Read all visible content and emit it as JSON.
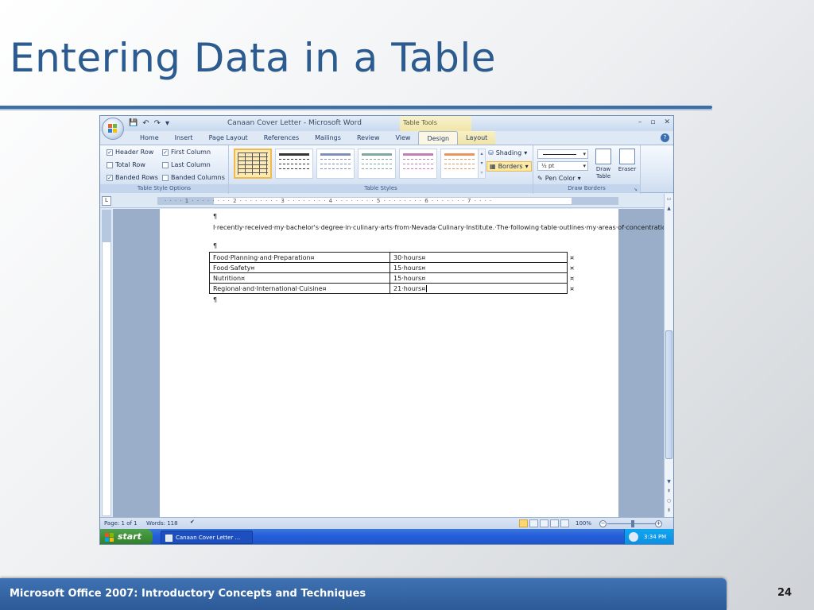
{
  "slide": {
    "title": "Entering Data in a Table",
    "footer": "Microsoft Office 2007: Introductory Concepts and Techniques",
    "page_number": "24"
  },
  "window": {
    "title": "Canaan Cover Letter - Microsoft Word",
    "context_title": "Table Tools",
    "controls": {
      "minimize": "–",
      "restore": "▫",
      "close": "✕"
    }
  },
  "quick_access": {
    "save": "💾",
    "undo": "↶",
    "redo": "↷",
    "more": "▾"
  },
  "tabs": [
    {
      "label": "Home"
    },
    {
      "label": "Insert"
    },
    {
      "label": "Page Layout"
    },
    {
      "label": "References"
    },
    {
      "label": "Mailings"
    },
    {
      "label": "Review"
    },
    {
      "label": "View"
    },
    {
      "label": "Design"
    },
    {
      "label": "Layout"
    }
  ],
  "active_tab": "Design",
  "ribbon": {
    "table_style_options": {
      "label": "Table Style Options",
      "options": [
        {
          "label": "Header Row",
          "checked": true
        },
        {
          "label": "First Column",
          "checked": true
        },
        {
          "label": "Total Row",
          "checked": false
        },
        {
          "label": "Last Column",
          "checked": false
        },
        {
          "label": "Banded Rows",
          "checked": true
        },
        {
          "label": "Banded Columns",
          "checked": false
        }
      ],
      "check_mark": "✓"
    },
    "table_styles": {
      "label": "Table Styles",
      "style_colors": [
        "#6a6a6a",
        "#333333",
        "#7d8fb7",
        "#7fa7a1",
        "#c17fb6",
        "#e8965f"
      ],
      "shading": "Shading",
      "borders": "Borders"
    },
    "draw_borders": {
      "label": "Draw Borders",
      "line_weight": "½ pt",
      "pen_color": "Pen Color",
      "draw_table": "Draw Table",
      "eraser": "Eraser"
    }
  },
  "ruler": {
    "corner": "L",
    "ticks": "· · · · 1 · · · · · · · · 2 · · · · · · · · 3 · · · · · · · · 4 · · · · · · · · 5 · · · · · · · · 6 · · · · · · · 7 · · · ·"
  },
  "document": {
    "pilcrow": "¶",
    "intro": "I·recently·received·my·bachelor's·degree·in·culinary·arts·from·Nevada·Culinary·Institute.·The·following·table·outlines·my·areas·of·concentration:¶",
    "cell_mark": "¤",
    "table": [
      {
        "area": "Food·Planning·and·Preparation¤",
        "hours": "30·hours¤"
      },
      {
        "area": "Food·Safety¤",
        "hours": "15·hours¤"
      },
      {
        "area": "Nutrition¤",
        "hours": "15·hours¤"
      },
      {
        "area": "Regional·and·International·Cuisine¤",
        "hours": "21·hours¤"
      }
    ]
  },
  "status_bar": {
    "page": "Page: 1 of 1",
    "words": "Words: 118",
    "zoom": "100%",
    "zoom_minus": "−",
    "zoom_plus": "+"
  },
  "taskbar": {
    "start": "start",
    "task": "Canaan Cover Letter ...",
    "clock": "3:34 PM"
  },
  "icons": {
    "office_button": "office-logo-icon",
    "help": "help-icon",
    "shading": "paint-bucket-icon",
    "borders": "borders-icon",
    "pen_color": "pen-icon",
    "draw_table": "pencil-icon",
    "eraser": "eraser-icon",
    "proofing": "spelling-check-icon",
    "scroll_up": "▲",
    "scroll_down": "▼",
    "prev_page": "⇞",
    "next_page": "⇟",
    "select_browse": "○",
    "help_glyph": "?"
  }
}
